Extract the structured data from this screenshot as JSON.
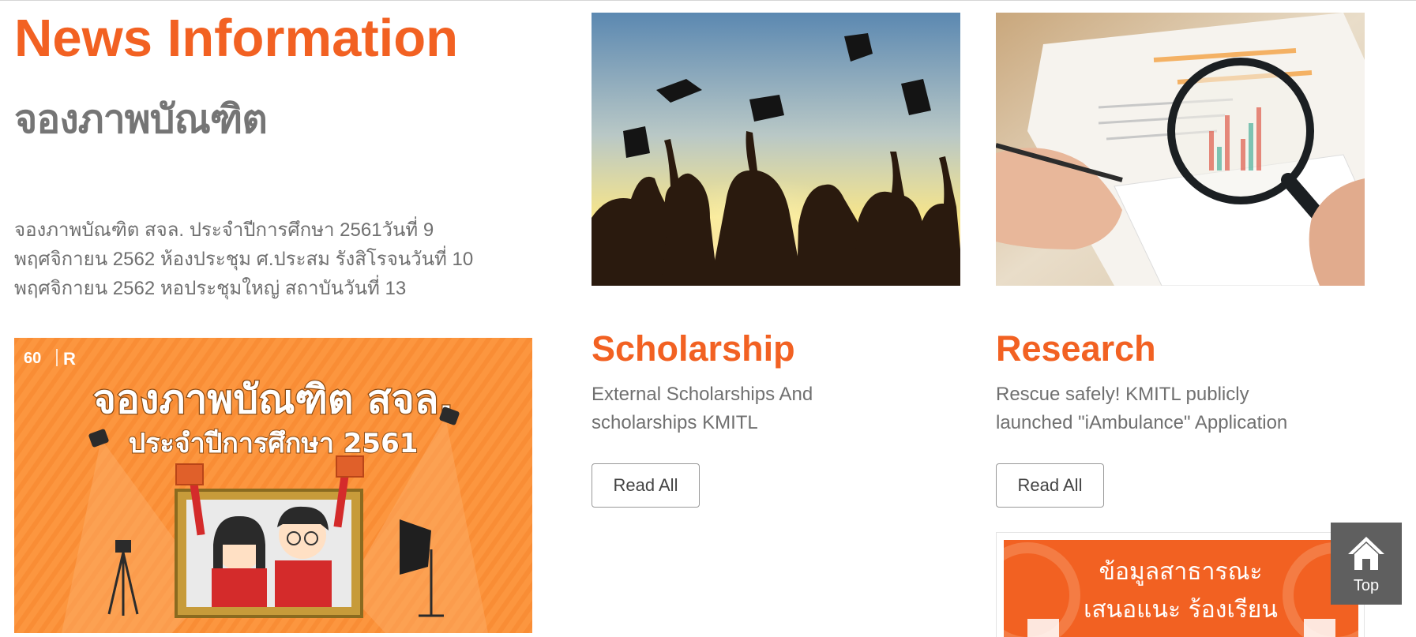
{
  "news": {
    "heading": "News Information",
    "title": "จองภาพบัณฑิต",
    "lines": [
      "จองภาพบัณฑิต สจล. ประจำปีการศึกษา 2561วันที่ 9",
      "พฤศจิกายน 2562 ห้องประชุม ศ.ประสม รังสิโรจนวันที่ 10",
      "พฤศจิกายน 2562 หอประชุมใหญ่ สถาบันวันที่ 13"
    ]
  },
  "banner": {
    "logo_left": "60",
    "logo_right": "R",
    "headline": "จองภาพบัณฑิต สจล.",
    "subline": "ประจำปีการศึกษา 2561",
    "background_color": "#fc963f"
  },
  "cards": [
    {
      "title": "Scholarship",
      "desc_lines": [
        "External Scholarships And",
        "scholarships KMITL"
      ],
      "button_label": "Read All",
      "image": "graduation-caps-photo"
    },
    {
      "title": "Research",
      "desc_lines": [
        "Rescue safely! KMITL publicly",
        "launched \"iAmbulance\" Application"
      ],
      "button_label": "Read All",
      "image": "magnifying-glass-document-photo"
    }
  ],
  "info_banner": {
    "line1": "ข้อมูลสาธารณะ",
    "line2": "เสนอแนะ  ร้องเรียน",
    "background_color": "#f26122"
  },
  "top_button": {
    "label": "Top",
    "icon": "home-icon"
  },
  "colors": {
    "accent": "#f26122",
    "body_text": "#707070",
    "subtitle_gray": "#757575",
    "top_button_bg": "#5f5f5f"
  }
}
